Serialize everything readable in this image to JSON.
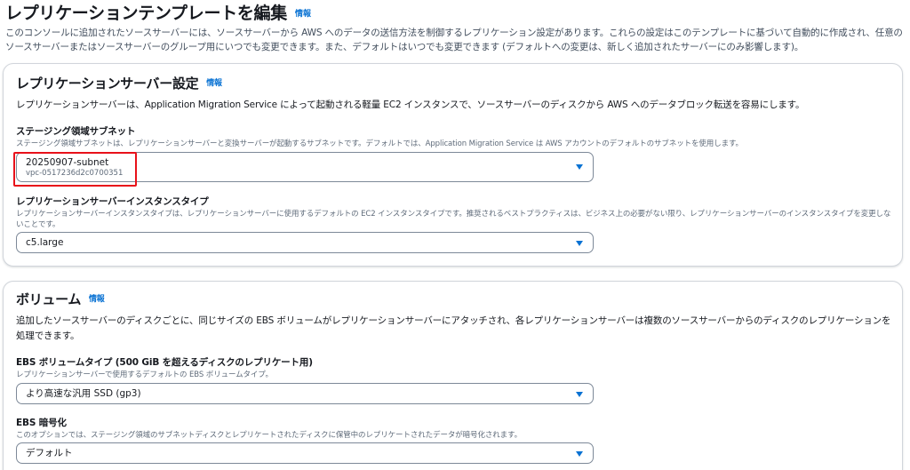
{
  "header": {
    "title": "レプリケーションテンプレートを編集",
    "info": "情報",
    "description": "このコンソールに追加されたソースサーバーには、ソースサーバーから AWS へのデータの送信方法を制御するレプリケーション設定があります。これらの設定はこのテンプレートに基づいて自動的に作成され、任意のソースサーバーまたはソースサーバーのグループ用にいつでも変更できます。また、デフォルトはいつでも変更できます (デフォルトへの変更は、新しく追加されたサーバーにのみ影響します)。"
  },
  "replication": {
    "title": "レプリケーションサーバー設定",
    "info": "情報",
    "description": "レプリケーションサーバーは、Application Migration Service によって起動される軽量 EC2 インスタンスで、ソースサーバーのディスクから AWS へのデータブロック転送を容易にします。",
    "subnet": {
      "label": "ステージング領域サブネット",
      "description": "ステージング領域サブネットは、レプリケーションサーバーと変換サーバーが起動するサブネットです。デフォルトでは、Application Migration Service は AWS アカウントのデフォルトのサブネットを使用します。",
      "value": "20250907-subnet",
      "sub": "vpc-0517236d2c0700351"
    },
    "instance": {
      "label": "レプリケーションサーバーインスタンスタイプ",
      "description": "レプリケーションサーバーインスタンスタイプは、レプリケーションサーバーに使用するデフォルトの EC2 インスタンスタイプです。推奨されるベストプラクティスは、ビジネス上の必要がない限り、レプリケーションサーバーのインスタンスタイプを変更しないことです。",
      "value": "c5.large"
    }
  },
  "volume": {
    "title": "ボリューム",
    "info": "情報",
    "description": "追加したソースサーバーのディスクごとに、同じサイズの EBS ボリュームがレプリケーションサーバーにアタッチされ、各レプリケーションサーバーは複数のソースサーバーからのディスクのレプリケーションを処理できます。",
    "type": {
      "label": "EBS ボリュームタイプ (500 GiB を超えるディスクのレプリケート用)",
      "description": "レプリケーションサーバーで使用するデフォルトの EBS ボリュームタイプ。",
      "value": "より高速な汎用 SSD (gp3)"
    },
    "encryption": {
      "label": "EBS 暗号化",
      "description": "このオプションでは、ステージング領域のサブネットディスクとレプリケートされたディスクに保管中のレプリケートされたデータが暗号化されます。",
      "value": "デフォルト"
    }
  },
  "colors": {
    "link": "#0972d3",
    "highlight": "#e8111a",
    "border": "#7d8998"
  },
  "icons": {
    "dropdown": "caret-down-icon"
  }
}
